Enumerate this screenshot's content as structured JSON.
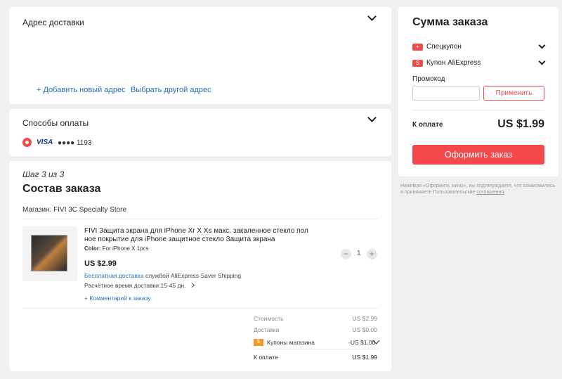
{
  "address": {
    "title": "Адрес доставки",
    "add_link": "+ Добавить новый адрес",
    "choose_link": "Выбрать другой адрес"
  },
  "payment": {
    "title": "Способы оплаты",
    "card_brand": "VISA",
    "card_mask": "●●●● 1193"
  },
  "order": {
    "step": "Шаг 3 из 3",
    "title": "Состав заказа",
    "store": "Магазин: FIVI 3C Specialty Store",
    "item": {
      "title_line1": "FIVI Защита экрана для iPhone Xr X Xs макс. закаленное стекло пол",
      "title_line2": "ное покрытие для iPhone защитное стекло Защита экрана",
      "color_label": "Color:",
      "color_value": "For iPhone X 1pcs",
      "price": "US $2.99",
      "qty": "1",
      "qty_minus": "−",
      "qty_plus": "+",
      "free_shipping": "Бесплатная доставка",
      "shipping_service": "службой AliExpress Saver Shipping",
      "delivery_time": "Расчётное время доставки:15-45 дн."
    },
    "comment_link": "+ Комментарий к заказу",
    "summary": {
      "cost_label": "Стоимость",
      "cost_value": "US $2.99",
      "shipping_label": "Доставка",
      "shipping_value": "US $0.00",
      "coupons_label": "Купоны магазина",
      "coupons_value": "-US $1.00",
      "total_label": "К оплате",
      "total_value": "US $1.99"
    }
  },
  "sidebar": {
    "title": "Сумма заказа",
    "special_coupon": "Спецкупон",
    "ae_coupon": "Купон AliExpress",
    "promo_label": "Промокод",
    "promo_placeholder": "",
    "apply_button": "Применить",
    "total_label": "К оплате",
    "total_value": "US $1.99",
    "checkout_button": "Оформить заказ",
    "coupon_icon_plus": "+",
    "coupon_icon_s": "S",
    "store_coupon_icon": "$"
  },
  "legal": {
    "text_before": "Нажимая «Оформить заказ», вы подтверждаете, что ознакомились и принимаете Пользовательские ",
    "agreement_link": "соглашения",
    "text_after": "."
  },
  "colors": {
    "accent": "#f5484a",
    "link": "#2b6fb6",
    "background": "#f0f0f0"
  }
}
